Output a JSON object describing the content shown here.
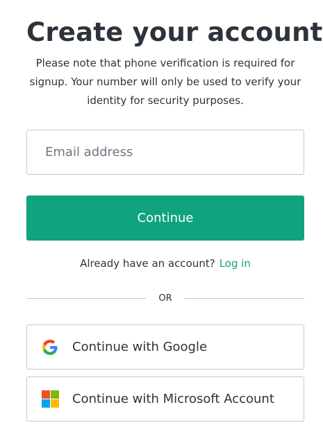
{
  "header": {
    "title": "Create your account",
    "subtitle": "Please note that phone verification is required for signup. Your number will only be used to verify your identity for security purposes."
  },
  "email": {
    "value": "",
    "placeholder": "Email address"
  },
  "continue_label": "Continue",
  "login_prompt": {
    "text": "Already have an account?",
    "link": "Log in"
  },
  "divider_label": "OR",
  "social": {
    "google": {
      "label": "Continue with Google",
      "icon": "google-icon"
    },
    "microsoft": {
      "label": "Continue with Microsoft Account",
      "icon": "microsoft-icon"
    }
  },
  "colors": {
    "accent": "#10a37f",
    "text": "#2d333a",
    "border": "#c2c8d0"
  }
}
